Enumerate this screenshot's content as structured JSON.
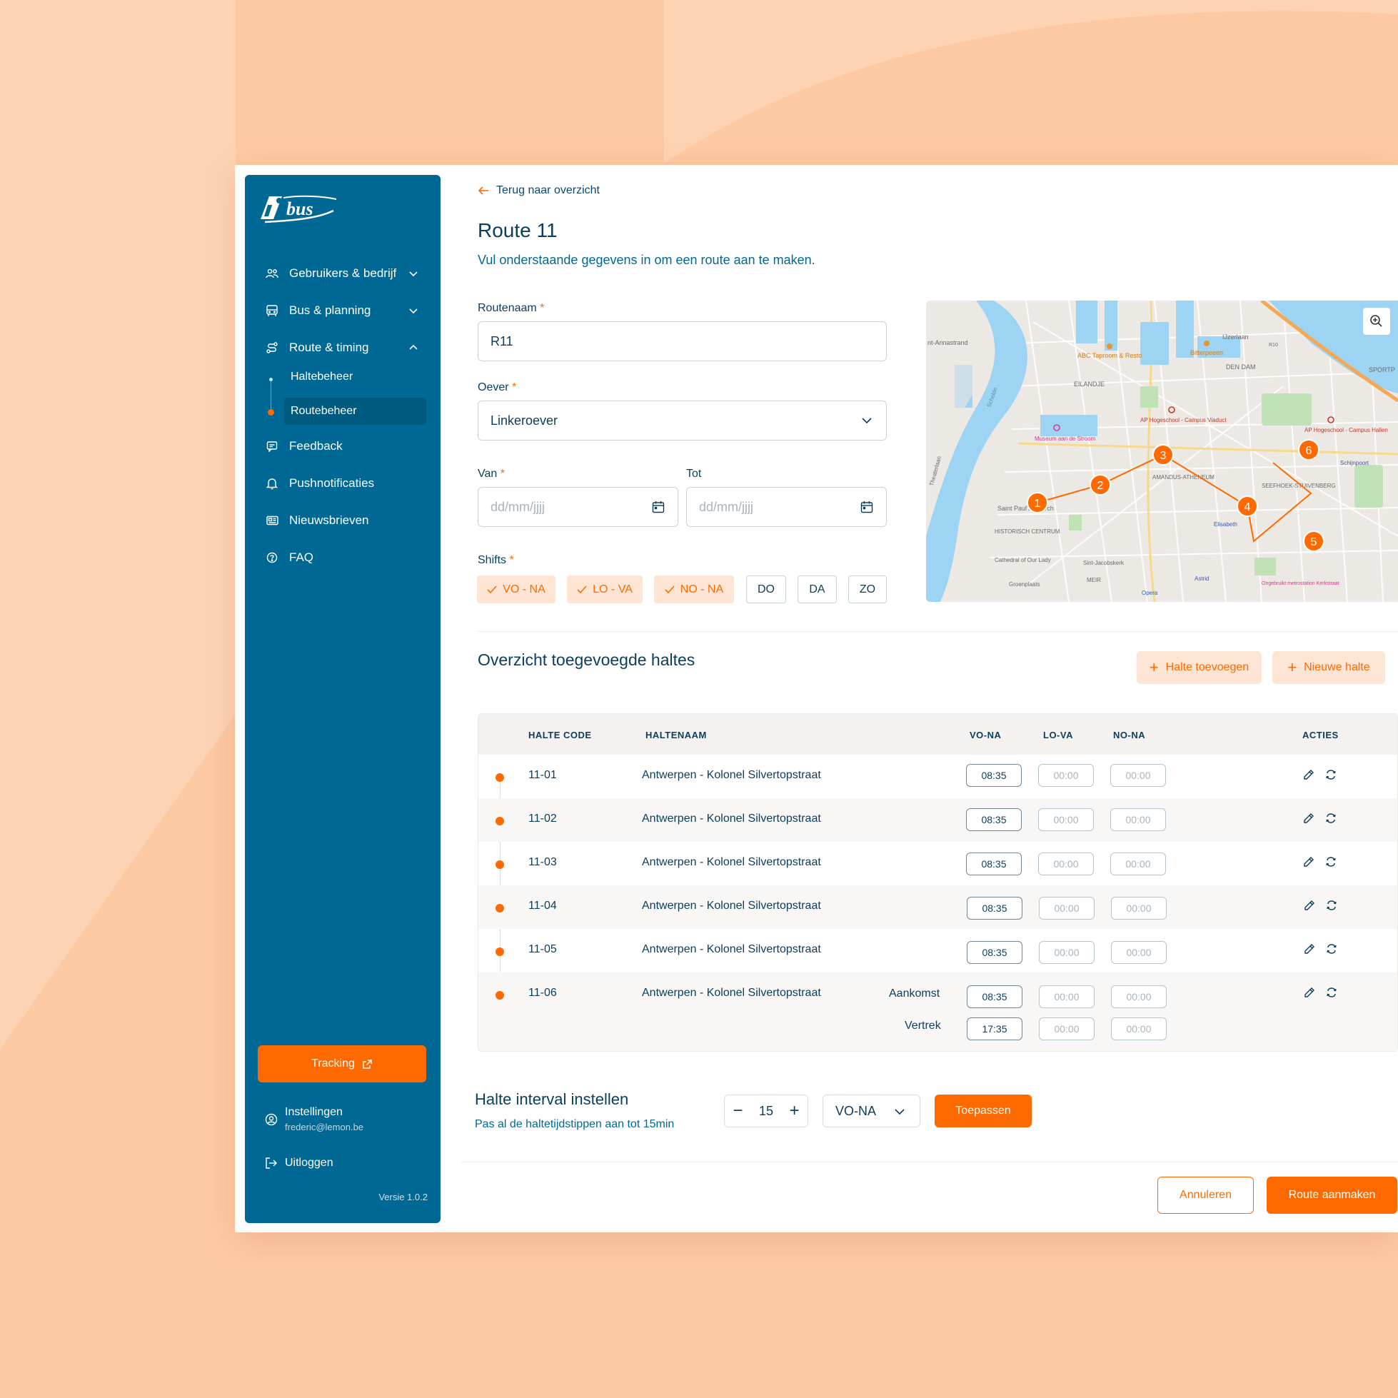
{
  "brand": {
    "logo_text": "bus",
    "primary": "#006894",
    "accent": "#ff6a00"
  },
  "sidebar": {
    "items": [
      {
        "label": "Gebruikers & bedrijf",
        "icon": "users-icon"
      },
      {
        "label": "Bus & planning",
        "icon": "bus-icon"
      },
      {
        "label": "Route & timing",
        "icon": "route-icon"
      },
      {
        "label": "Feedback",
        "icon": "chat-icon"
      },
      {
        "label": "Pushnotificaties",
        "icon": "bell-icon"
      },
      {
        "label": "Nieuwsbrieven",
        "icon": "newsletter-icon"
      },
      {
        "label": "FAQ",
        "icon": "help-icon"
      }
    ],
    "sub_items": [
      "Haltebeheer",
      "Routebeheer"
    ],
    "tracking_label": "Tracking",
    "settings_label": "Instellingen",
    "user_email": "frederic@lemon.be",
    "logout_label": "Uitloggen",
    "version": "Versie 1.0.2"
  },
  "main": {
    "back_label": "Terug naar overzicht",
    "title": "Route 11",
    "subtitle": "Vul onderstaande gegevens in om een route aan te maken.",
    "form": {
      "route_name_label": "Routenaam",
      "route_name_value": "R11",
      "bank_label": "Oever",
      "bank_value": "Linkeroever",
      "from_label": "Van",
      "to_label": "Tot",
      "date_placeholder": "dd/mm/jjjj",
      "shifts_label": "Shifts",
      "required_mark": "*",
      "shifts": [
        {
          "label": "VO - NA",
          "selected": true
        },
        {
          "label": "LO - VA",
          "selected": true
        },
        {
          "label": "NO - NA",
          "selected": true
        },
        {
          "label": "DO",
          "selected": false
        },
        {
          "label": "DA",
          "selected": false
        },
        {
          "label": "ZO",
          "selected": false
        }
      ]
    },
    "map": {
      "labels": [
        "nt-Annastrand",
        "ABC Taproom & Resto",
        "Bitterpeeen",
        "IJzerlaan",
        "R10",
        "DEN DAM",
        "SPORTP",
        "EILANDJE",
        "AP Hogeschool - Campus Viaduct",
        "AP Hogeschool - Campus Hallen",
        "Museum aan de Stroom",
        "AMANDUS-ATHENEUM",
        "SEEFHOEK-STUIVENBERG",
        "Schijnpoort",
        "Saint Paul's Church",
        "HISTORISCH CENTRUM",
        "Cathedral of Our Lady",
        "Sint-Jacobskerk",
        "Elisabeth",
        "Groenplaats",
        "MEIR",
        "Opera",
        "Astrid",
        "Ongebruikt metrostation Kerkstraat",
        "Schelde",
        "Theaterlaan"
      ],
      "markers": [
        "1",
        "2",
        "3",
        "4",
        "5",
        "6"
      ]
    },
    "stops_section": {
      "title": "Overzicht toegevoegde haltes",
      "add_stop_label": "Halte toevoegen",
      "new_stop_label": "Nieuwe halte",
      "columns": [
        "HALTE CODE",
        "HALTENAAM",
        "VO-NA",
        "LO-VA",
        "NO-NA",
        "ACTIES"
      ],
      "rows": [
        {
          "code": "11-01",
          "name": "Antwerpen - Kolonel Silvertopstraat",
          "vo": "08:35",
          "lo": "00:00",
          "no": "00:00"
        },
        {
          "code": "11-02",
          "name": "Antwerpen - Kolonel Silvertopstraat",
          "vo": "08:35",
          "lo": "00:00",
          "no": "00:00"
        },
        {
          "code": "11-03",
          "name": "Antwerpen - Kolonel Silvertopstraat",
          "vo": "08:35",
          "lo": "00:00",
          "no": "00:00"
        },
        {
          "code": "11-04",
          "name": "Antwerpen - Kolonel Silvertopstraat",
          "vo": "08:35",
          "lo": "00:00",
          "no": "00:00"
        },
        {
          "code": "11-05",
          "name": "Antwerpen - Kolonel Silvertopstraat",
          "vo": "08:35",
          "lo": "00:00",
          "no": "00:00"
        },
        {
          "code": "11-06",
          "name": "Antwerpen - Kolonel Silvertopstraat",
          "vo": "08:35",
          "lo": "00:00",
          "no": "00:00",
          "arrival_label": "Aankomst",
          "departure_label": "Vertrek",
          "dep_vo": "17:35",
          "dep_lo": "00:00",
          "dep_no": "00:00"
        }
      ]
    },
    "interval": {
      "title": "Halte interval instellen",
      "subtitle": "Pas al de haltetijdstippen aan tot 15min",
      "value": "15",
      "shift": "VO-NA",
      "apply_label": "Toepassen"
    },
    "footer": {
      "cancel_label": "Annuleren",
      "create_label": "Route aanmaken"
    }
  }
}
